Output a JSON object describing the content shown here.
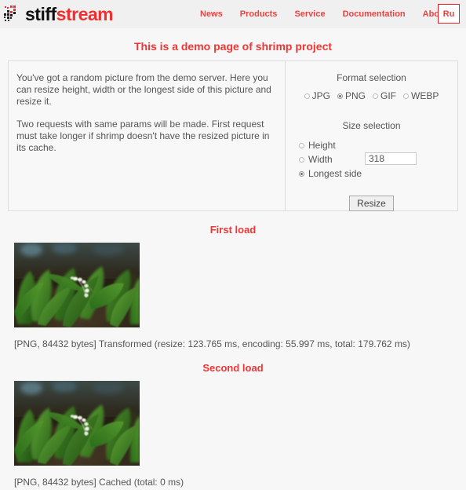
{
  "header": {
    "logo": {
      "icon": "pixel-blocks-logo-icon",
      "text_dark": "stiff",
      "text_red": "stream"
    },
    "nav": [
      {
        "label": "News"
      },
      {
        "label": "Products"
      },
      {
        "label": "Service"
      },
      {
        "label": "Documentation"
      },
      {
        "label": "About"
      }
    ],
    "lang_button": "Ru",
    "background": "#f0f0f0",
    "accent": "#f04040"
  },
  "page": {
    "title": "This is a demo page of shrimp project",
    "title_color": "#f03535",
    "background": "#f7f7f7"
  },
  "info_panel": {
    "paragraph1": "You've got a random picture from the demo server. Here you can resize height, width or the longest side of this picture and resize it.",
    "paragraph2": "Two requests with same params will be made. First request must take longer if shrimp doesn't have the resized picture in its cache."
  },
  "controls": {
    "format_title": "Format selection",
    "formats": [
      {
        "label": "JPG",
        "selected": false
      },
      {
        "label": "PNG",
        "selected": true
      },
      {
        "label": "GIF",
        "selected": false
      },
      {
        "label": "WEBP",
        "selected": false
      }
    ],
    "size_title": "Size selection",
    "size_options": [
      {
        "label": "Height",
        "selected": false
      },
      {
        "label": "Width",
        "selected": false
      },
      {
        "label": "Longest side",
        "selected": true
      }
    ],
    "size_input_value": "318",
    "size_input_placeholder": "",
    "resize_button": "Resize"
  },
  "first_load": {
    "title": "First load",
    "image_alt": "lily-of-the-valley-photo",
    "status": "[PNG, 84432 bytes] Transformed (resize: 123.765 ms, encoding: 55.997 ms, total: 179.762 ms)"
  },
  "second_load": {
    "title": "Second load",
    "image_alt": "lily-of-the-valley-photo",
    "status": "[PNG, 84432 bytes] Cached (total: 0 ms)"
  }
}
